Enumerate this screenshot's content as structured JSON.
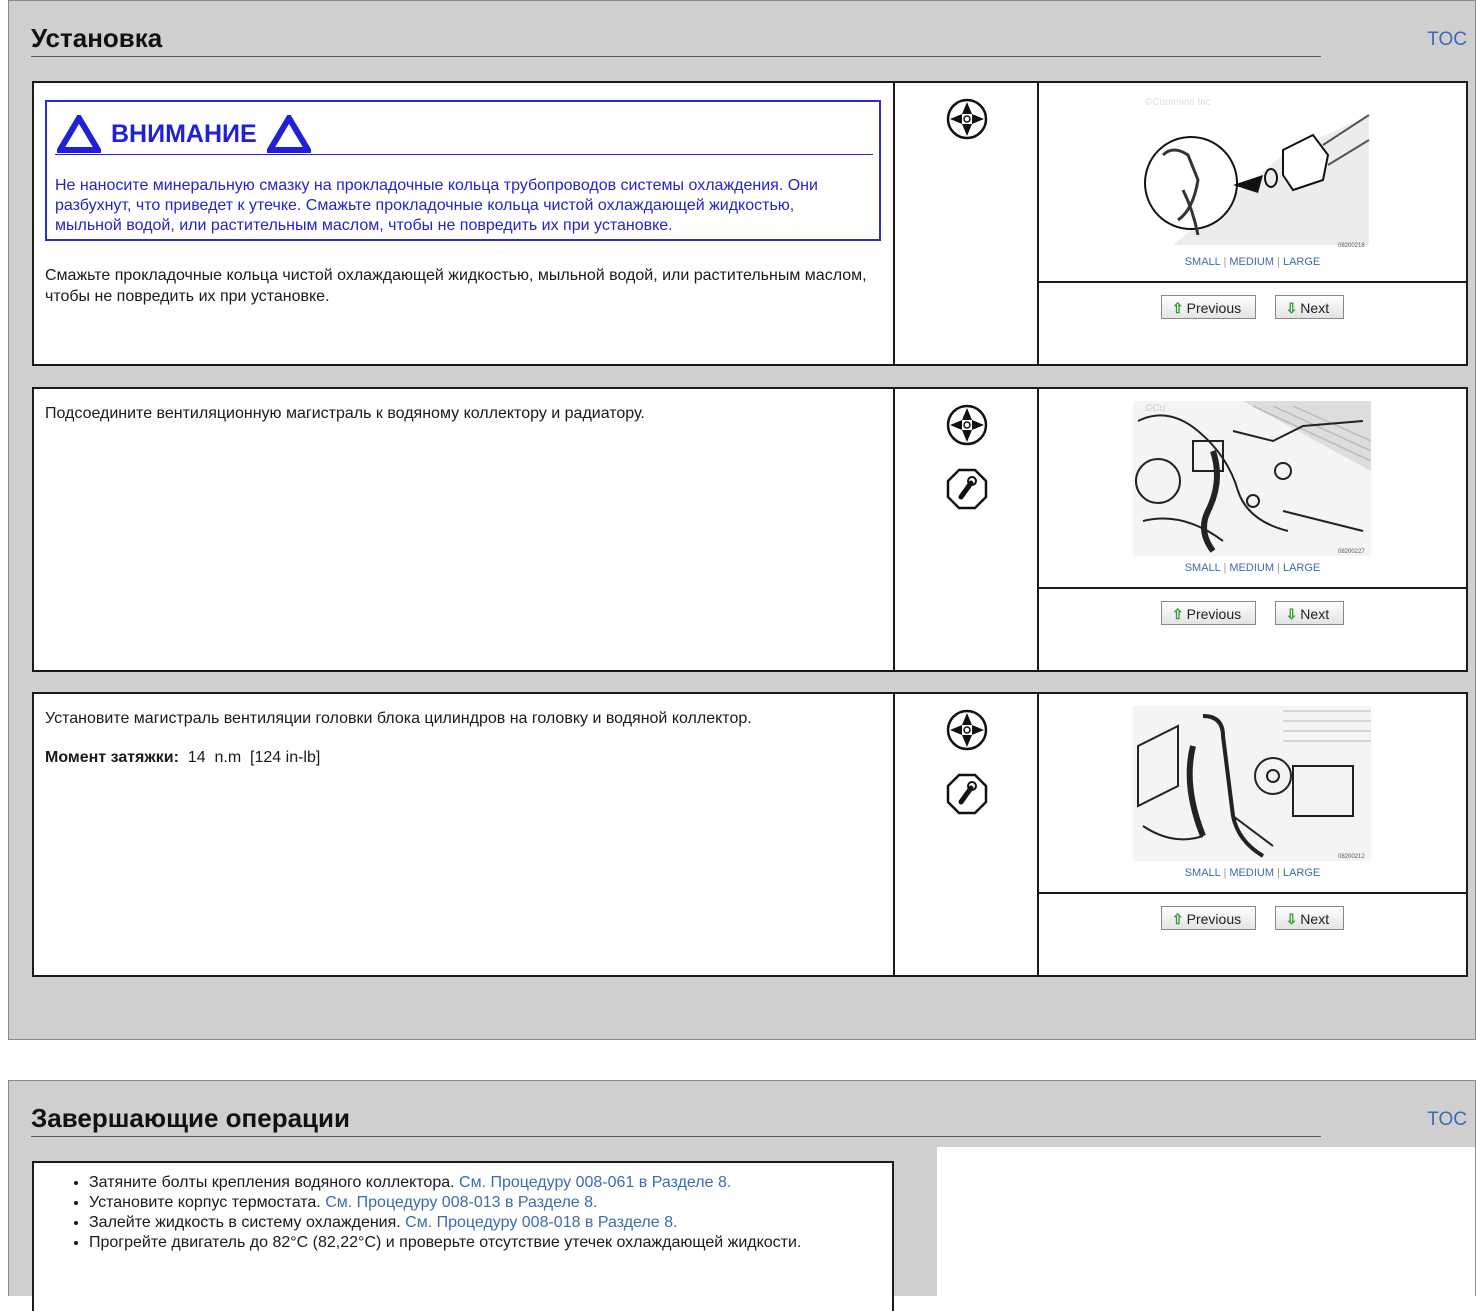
{
  "section1": {
    "title": "Установка",
    "toc": "TOC",
    "steps": [
      {
        "warning_title": "ВНИМАНИЕ",
        "warning_text": "Не наносите минеральную смазку на прокладочные кольца трубопроводов системы охлаждения. Они разбухнут, что приведет к утечке. Смажьте прокладочные кольца чистой охлаждающей жидкостью, мыльной водой, или растительным маслом, чтобы не повредить их при установке.",
        "text": "Смажьте прокладочные кольца чистой охлаждающей жидкостью, мыльной водой, или растительным маслом, чтобы не повредить их при установке.",
        "icons": [
          "lubricant-icon"
        ],
        "image": {
          "copyright": "©Cummins Inc",
          "code": "08200218"
        }
      },
      {
        "text": "Подсоедините вентиляционную магистраль к водяному коллектору и радиатору.",
        "icons": [
          "lubricant-icon",
          "wrench-icon"
        ],
        "image": {
          "copyright": "©Cu",
          "code": "08200227"
        }
      },
      {
        "text": "Установите магистраль вентиляции головки блока цилиндров на головку и водяной коллектор.",
        "torque_label": "Момент затяжки:",
        "torque_value": "14",
        "torque_unit": "n.m",
        "torque_alt": "[124 in-lb]",
        "icons": [
          "lubricant-icon",
          "wrench-icon"
        ],
        "image": {
          "copyright": "©Cummins Inc",
          "code": "08200212"
        }
      }
    ],
    "size_links": {
      "small": "SMALL",
      "medium": "MEDIUM",
      "large": "LARGE",
      "sep": "|"
    },
    "buttons": {
      "previous": "Previous",
      "next": "Next"
    }
  },
  "section2": {
    "title": "Завершающие операции",
    "toc": "TOC",
    "items": [
      {
        "text": "Затяните болты крепления водяного коллектора.",
        "ref": "См. Процедуру 008-061 в Разделе 8."
      },
      {
        "text": "Установите корпус термостата.",
        "ref": "См. Процедуру 008-013 в Разделе 8."
      },
      {
        "text": "Залейте жидкость в систему охлаждения.",
        "ref": "См. Процедуру 008-018 в Разделе 8."
      },
      {
        "text": "Прогрейте двигатель до 82°C (82,22°C) и проверьте отсутствие утечек охлаждающей жидкости.",
        "ref": ""
      }
    ]
  },
  "colors": {
    "link": "#3c6bb0",
    "warning": "#2020d8",
    "panel_bg": "#cfcfcf"
  }
}
